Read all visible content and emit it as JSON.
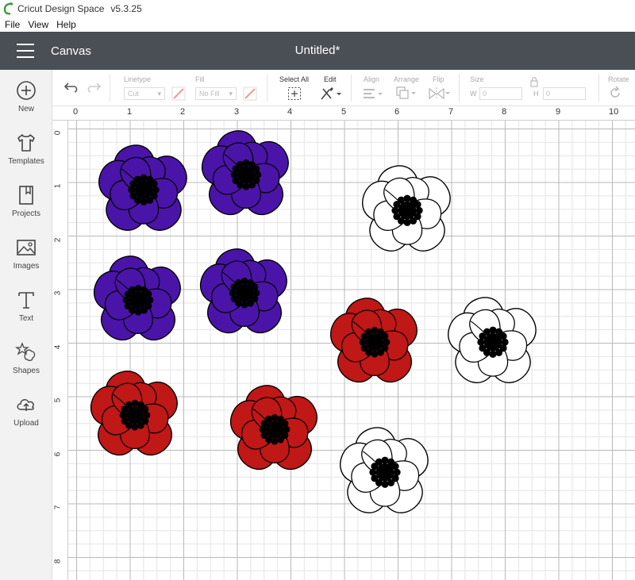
{
  "app": {
    "title": "Cricut Design Space",
    "version": "v5.3.25"
  },
  "menu": [
    "File",
    "View",
    "Help"
  ],
  "header": {
    "section": "Canvas",
    "document_title": "Untitled*"
  },
  "sidebar": [
    {
      "label": "New",
      "icon": "plus-circle-icon"
    },
    {
      "label": "Templates",
      "icon": "tshirt-icon"
    },
    {
      "label": "Projects",
      "icon": "bookmark-book-icon"
    },
    {
      "label": "Images",
      "icon": "image-icon"
    },
    {
      "label": "Text",
      "icon": "text-t-icon"
    },
    {
      "label": "Shapes",
      "icon": "shapes-icon"
    },
    {
      "label": "Upload",
      "icon": "cloud-upload-icon"
    }
  ],
  "toolbar": {
    "linetype_label": "Linetype",
    "linetype_value": "Cut",
    "fill_label": "Fill",
    "fill_value": "No Fill",
    "select_all_label": "Select All",
    "edit_label": "Edit",
    "align_label": "Align",
    "arrange_label": "Arrange",
    "flip_label": "Flip",
    "size_label": "Size",
    "w_label": "W",
    "w_value": "0",
    "h_label": "H",
    "h_value": "0",
    "rotate_label": "Rotate"
  },
  "ruler": {
    "x": [
      "0",
      "1",
      "2",
      "3",
      "4",
      "5",
      "6",
      "7",
      "8",
      "9",
      "10"
    ],
    "y": [
      "0",
      "1",
      "2",
      "3",
      "4",
      "5",
      "6",
      "7",
      "8"
    ]
  },
  "colors": {
    "header_bg": "#4a4f55",
    "purple": "#4b14a8",
    "red": "#c01717",
    "white": "#ffffff",
    "center": "#000000"
  },
  "flowers": [
    {
      "color": "purple"
    },
    {
      "color": "purple"
    },
    {
      "color": "purple"
    },
    {
      "color": "purple"
    },
    {
      "color": "red"
    },
    {
      "color": "red"
    },
    {
      "color": "red"
    },
    {
      "color": "white"
    },
    {
      "color": "white"
    },
    {
      "color": "white"
    }
  ]
}
